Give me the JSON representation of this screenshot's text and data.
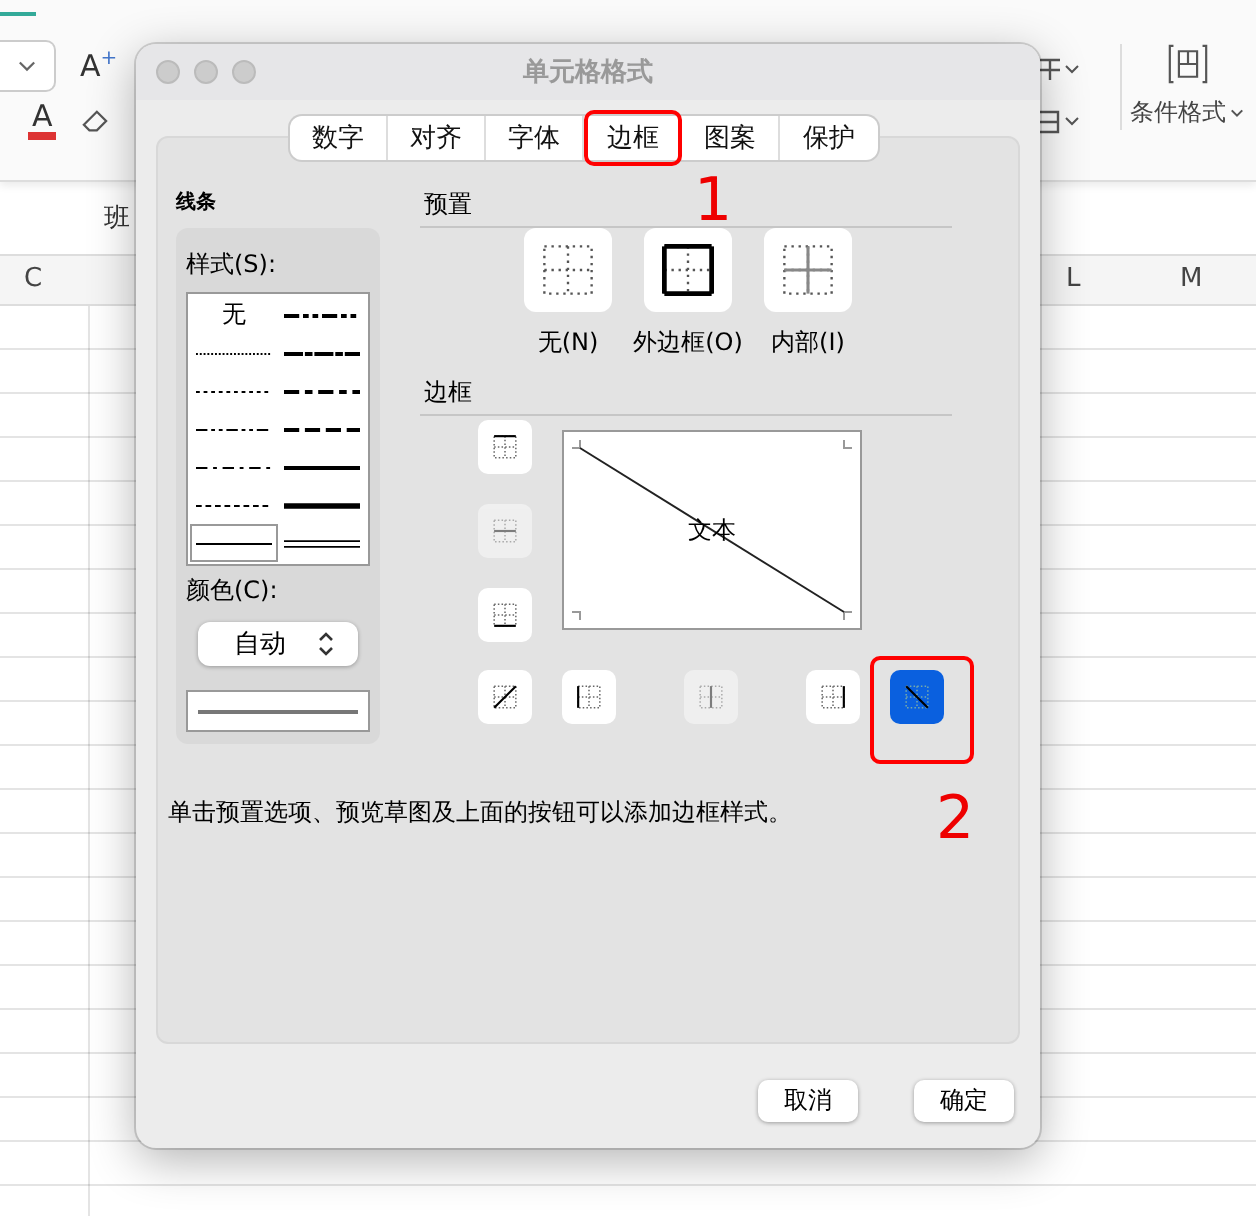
{
  "spreadsheet": {
    "font_grow": "A",
    "font_grow_sup": "+",
    "font_color": "A",
    "conditional_format": "条件格式",
    "name_box": "班",
    "columns": [
      "C",
      "L",
      "M"
    ]
  },
  "dialog": {
    "title": "单元格格式",
    "tabs": [
      {
        "label": "数字",
        "selected": false
      },
      {
        "label": "对齐",
        "selected": false
      },
      {
        "label": "字体",
        "selected": false
      },
      {
        "label": "边框",
        "selected": true
      },
      {
        "label": "图案",
        "selected": false
      },
      {
        "label": "保护",
        "selected": false
      }
    ],
    "line_section": "线条",
    "style_label": "样式(S):",
    "line_styles": [
      {
        "kind": "none",
        "label": "无",
        "selected": false
      },
      {
        "kind": "medium-dash-dot-dot",
        "selected": false
      },
      {
        "kind": "hair",
        "selected": false
      },
      {
        "kind": "slant-dash-dot",
        "selected": false
      },
      {
        "kind": "dotted",
        "selected": false
      },
      {
        "kind": "medium-dash-dot",
        "selected": false
      },
      {
        "kind": "dash-dot-dot",
        "selected": false
      },
      {
        "kind": "medium-dashed",
        "selected": false
      },
      {
        "kind": "dash-dot",
        "selected": false
      },
      {
        "kind": "medium",
        "selected": false
      },
      {
        "kind": "dashed",
        "selected": false
      },
      {
        "kind": "thick",
        "selected": false
      },
      {
        "kind": "thin",
        "selected": true
      },
      {
        "kind": "double",
        "selected": false
      }
    ],
    "color_label": "颜色(C):",
    "color_value": "自动",
    "preset_section": "预置",
    "presets": [
      {
        "kind": "none",
        "label": "无(N)"
      },
      {
        "kind": "outline",
        "label": "外边框(O)"
      },
      {
        "kind": "inside",
        "label": "内部(I)"
      }
    ],
    "border_section": "边框",
    "preview_text": "文本",
    "border_buttons": [
      {
        "kind": "top",
        "selected": false,
        "disabled": false
      },
      {
        "kind": "middle-h",
        "selected": false,
        "disabled": true
      },
      {
        "kind": "bottom",
        "selected": false,
        "disabled": false
      },
      {
        "kind": "diag-up",
        "selected": false,
        "disabled": false
      },
      {
        "kind": "left",
        "selected": false,
        "disabled": false
      },
      {
        "kind": "middle-v",
        "selected": false,
        "disabled": true
      },
      {
        "kind": "right",
        "selected": false,
        "disabled": false
      },
      {
        "kind": "diag-down",
        "selected": true,
        "disabled": false
      }
    ],
    "hint": "单击预置选项、预览草图及上面的按钮可以添加边框样式。",
    "buttons": [
      "取消",
      "确定"
    ]
  },
  "annotations": [
    "1",
    "2"
  ]
}
